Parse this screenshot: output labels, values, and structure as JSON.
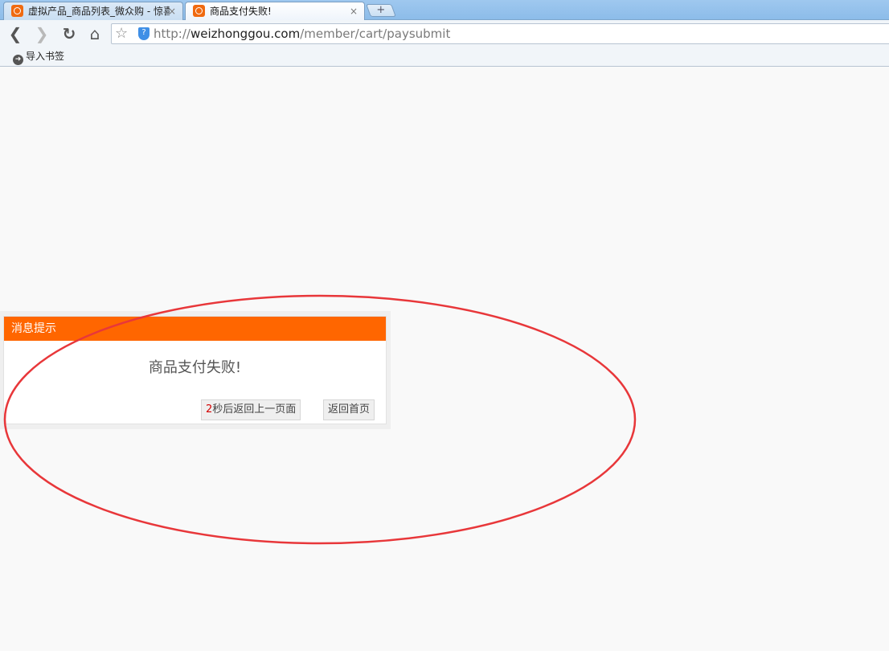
{
  "browser": {
    "tabs": [
      {
        "title": "虚拟产品_商品列表_微众购 - 惊喜",
        "close": "×",
        "active": false
      },
      {
        "title": "商品支付失败!",
        "close": "×",
        "active": true
      }
    ],
    "new_tab": "+",
    "toolbar": {
      "back_glyph": "❮",
      "forward_glyph": "❯",
      "reload_glyph": "↻",
      "home_glyph": "⌂",
      "star_glyph": "☆",
      "shield_glyph": "?",
      "url_prefix": "http://",
      "url_host": "weizhonggou.com",
      "url_path": "/member/cart/paysubmit"
    },
    "bookmarks": {
      "import_label": "导入书签",
      "import_glyph": "➜"
    }
  },
  "message": {
    "header": "消息提示",
    "text": "商品支付失败!",
    "countdown_seconds": "2",
    "back_prev_label": "秒后返回上一页面",
    "back_home_label": "返回首页",
    "header_color": "#ff6600"
  },
  "annotation": {
    "shape": "ellipse",
    "color": "#e8373a"
  },
  "icons": {
    "favicon": "weizhonggou-logo-icon",
    "back": "back-arrow-icon",
    "forward": "forward-arrow-icon",
    "reload": "reload-icon",
    "home": "home-icon",
    "star": "star-icon",
    "shield": "shield-icon",
    "import": "import-arrow-icon"
  }
}
